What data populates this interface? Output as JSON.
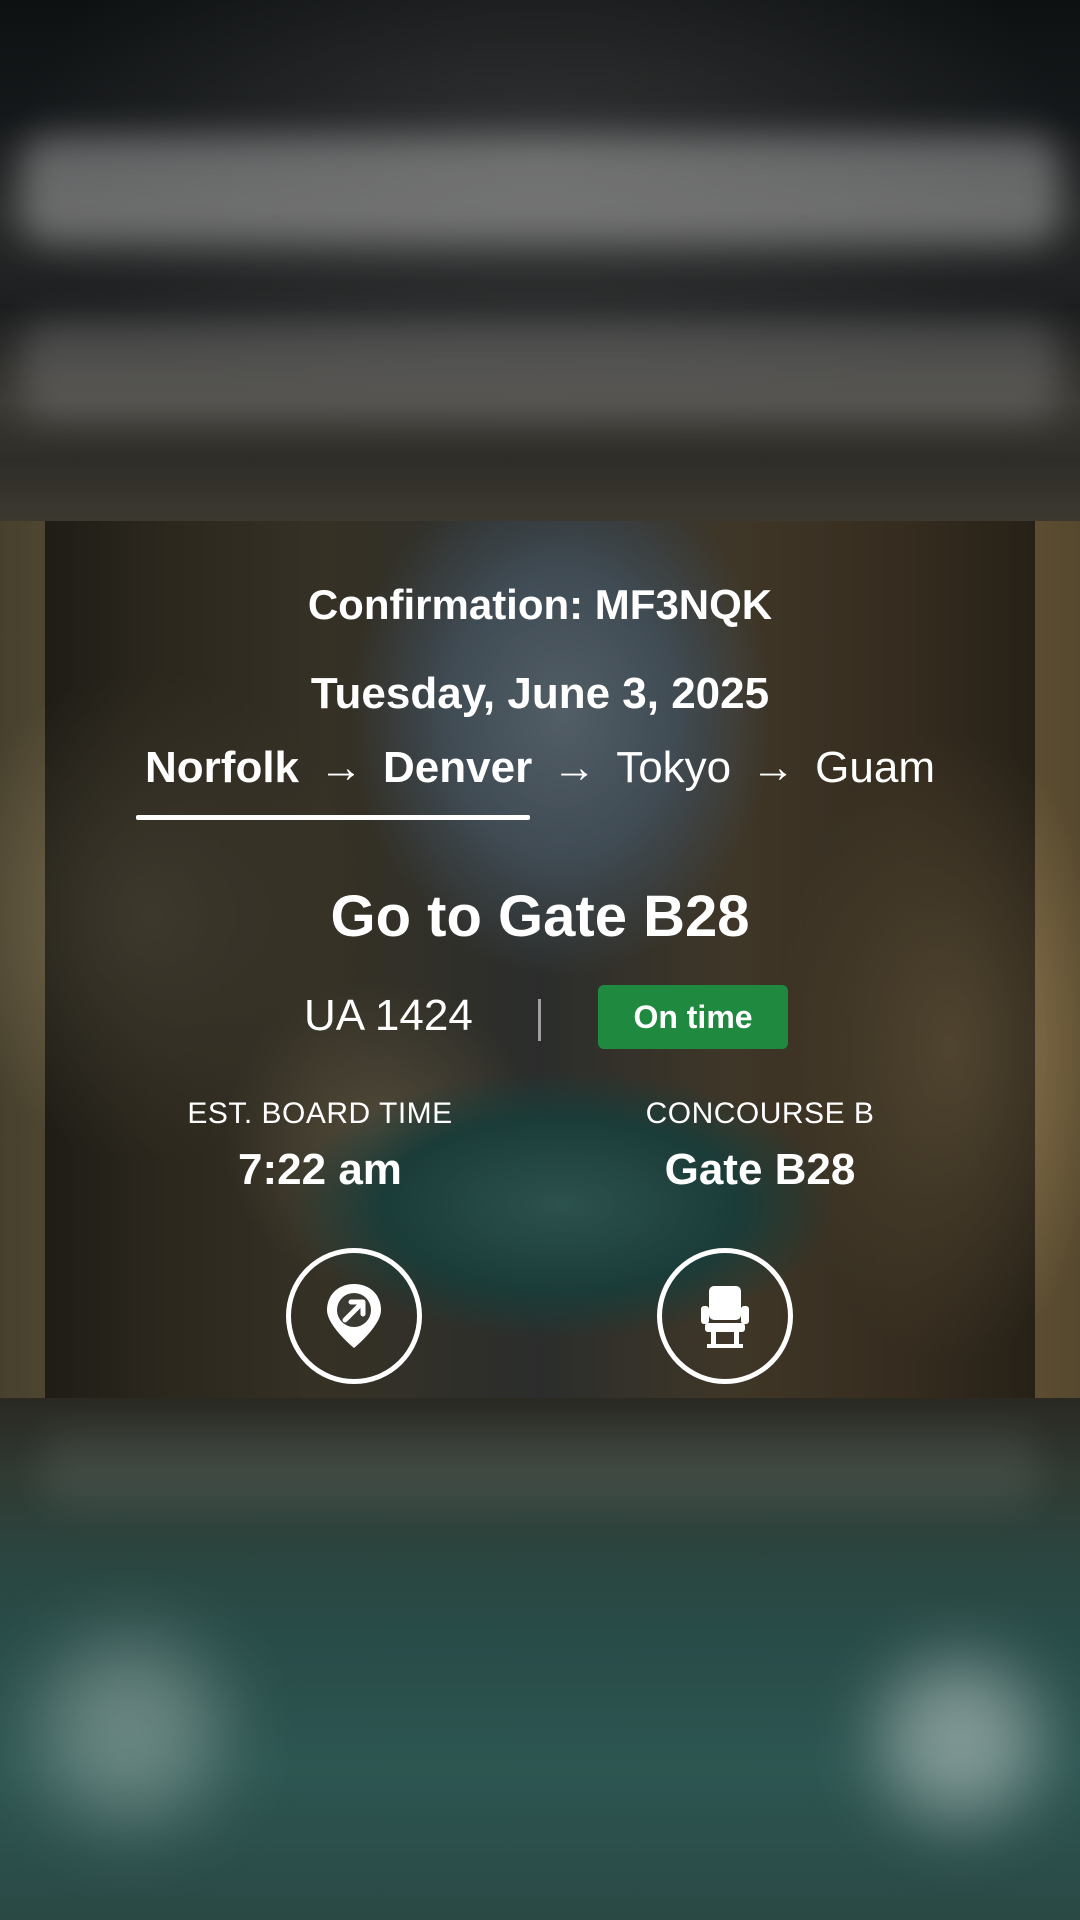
{
  "trip": {
    "confirmation": "Confirmation: MF3NQK",
    "date": "Tuesday, June 3, 2025",
    "route": [
      {
        "city": "Norfolk",
        "completed": true
      },
      {
        "city": "Denver",
        "completed": true
      },
      {
        "city": "Tokyo",
        "completed": false
      },
      {
        "city": "Guam",
        "completed": false
      }
    ],
    "arrow": "→"
  },
  "gate": {
    "headline": "Go to Gate B28",
    "flight_number": "UA 1424",
    "status": "On time",
    "status_color": "#1f8a3f",
    "board_time_label": "EST. BOARD TIME",
    "board_time_value": "7:22 am",
    "concourse_label": "CONCOURSE B",
    "gate_value": "Gate B28"
  },
  "actions": [
    {
      "icon": "directions-pin-icon"
    },
    {
      "icon": "seat-icon"
    }
  ]
}
